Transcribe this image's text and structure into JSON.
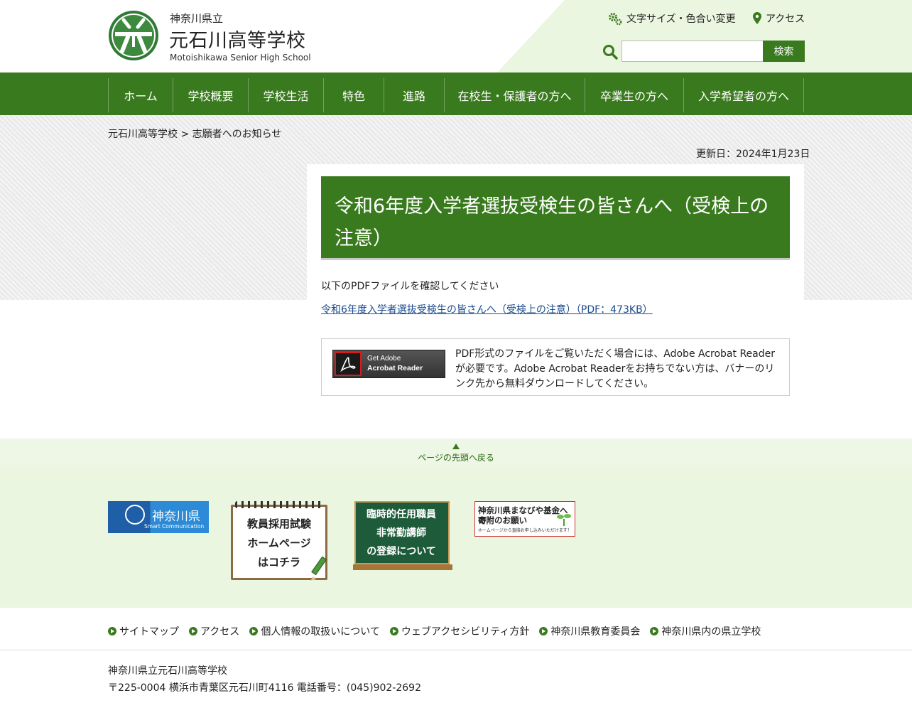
{
  "header": {
    "school_pref": "神奈川県立",
    "school_name": "元石川高等学校",
    "school_en": "Motoishikawa Senior High School",
    "font_color_link": "文字サイズ・色合い変更",
    "access_link": "アクセス",
    "search_placeholder": "",
    "search_button": "検索",
    "logo_icon": "school-emblem-icon"
  },
  "nav": {
    "items": [
      {
        "label": "ホーム"
      },
      {
        "label": "学校概要"
      },
      {
        "label": "学校生活"
      },
      {
        "label": "特色"
      },
      {
        "label": "進路"
      },
      {
        "label": "在校生・保護者の方へ"
      },
      {
        "label": "卒業生の方へ"
      },
      {
        "label": "入学希望者の方へ"
      }
    ]
  },
  "breadcrumb": {
    "home": "元石川高等学校",
    "separator": ">",
    "current": "志願者へのお知らせ"
  },
  "updated": "更新日：2024年1月23日",
  "main": {
    "title": "令和6年度入学者選抜受検生の皆さんへ（受検上の注意）",
    "intro": "以下のPDFファイルを確認してください",
    "pdf_link": "令和6年度入学者選抜受検生の皆さんへ（受検上の注意）（PDF：473KB）"
  },
  "adobe": {
    "banner_line1": "Get Adobe",
    "banner_line2": "Acrobat Reader",
    "note": "PDF形式のファイルをご覧いただく場合には、Adobe Acrobat Readerが必要です。Adobe Acrobat Readerをお持ちでない方は、バナーのリンク先から無料ダウンロードしてください。"
  },
  "pagetop": "ページの先頭へ戻る",
  "banners": {
    "kanagawa_title": "神奈川県",
    "kanagawa_sub": "Smart Communication",
    "kyoin_line1": "教員採用試験",
    "kyoin_line2": "ホームページ",
    "kyoin_line3": "はコチラ",
    "rinji_line1": "臨時的任用職員",
    "rinji_line2": "非常勤講師",
    "rinji_line3": "の登録について",
    "manabi_line1": "神奈川県まなびや基金への",
    "manabi_line2": "寄附のお願い",
    "manabi_line3": "ホームページから直接お申し込みいただけます！"
  },
  "footer": {
    "links": [
      {
        "label": "サイトマップ"
      },
      {
        "label": "アクセス"
      },
      {
        "label": "個人情報の取扱いについて"
      },
      {
        "label": "ウェブアクセシビリティ方針"
      },
      {
        "label": "神奈川県教育委員会"
      },
      {
        "label": "神奈川県内の県立学校"
      }
    ],
    "address_line1": "神奈川県立元石川高等学校",
    "address_line2": "〒225-0004 横浜市青葉区元石川町4116 電話番号：(045)902-2692"
  },
  "colors": {
    "brand_green": "#3a7a1e",
    "light_green": "#eaf6e0",
    "link_blue": "#1a4b8e"
  }
}
